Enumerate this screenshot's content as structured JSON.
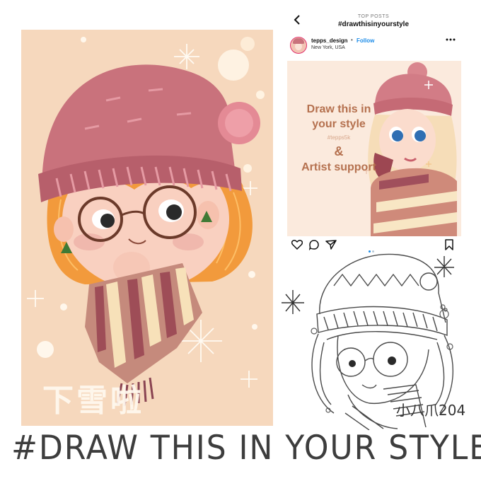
{
  "left_artwork": {
    "signature": "下雪啦",
    "colors": {
      "background": "#f6d8bd",
      "hair": "#f29a3c",
      "hat": "#c9727c",
      "skin": "#f9d0c0"
    }
  },
  "instagram_post": {
    "top_label": "TOP POSTS",
    "hashtag": "#drawthisinyourstyle",
    "back_icon": "chevron-left-icon",
    "username": "tepps_design",
    "separator": "•",
    "follow_label": "Follow",
    "location": "New York, USA",
    "more_icon": "more-dots-icon",
    "image_text": {
      "line1": "Draw this in your style",
      "tag": "#tepps5k",
      "amp": "&",
      "line2": "Artist support"
    },
    "actions": [
      "heart-icon",
      "comment-icon",
      "share-icon",
      "bookmark-icon"
    ],
    "carousel": {
      "count": 2,
      "active": 1
    },
    "colors": {
      "link": "#1a8be8",
      "text_brown": "#b5714f"
    }
  },
  "sketch": {
    "signature": "小八爪204"
  },
  "headline": "#DRAW THIS IN YOUR STYLE"
}
